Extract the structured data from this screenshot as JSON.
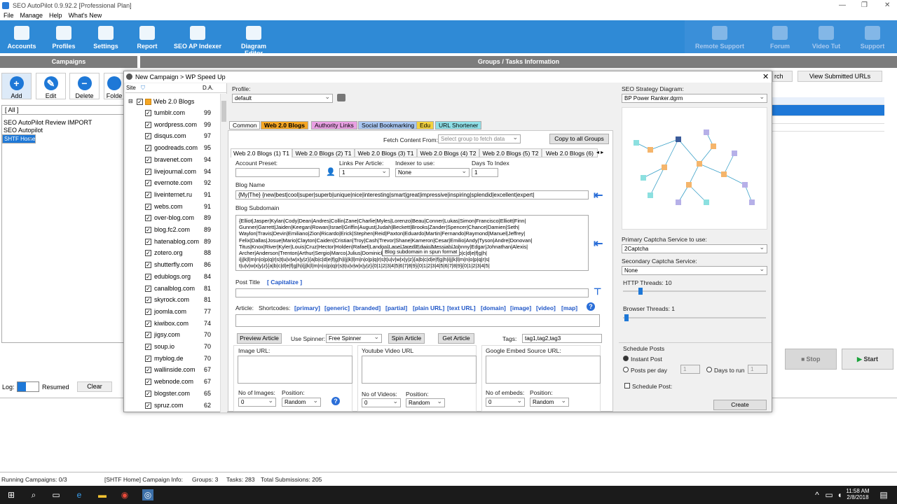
{
  "window": {
    "title": "SEO AutoPilot 0.9.92.2 [Professional Plan]"
  },
  "menu": [
    "File",
    "Manage",
    "Help",
    "What's New"
  ],
  "toolbar": {
    "left": [
      {
        "label": "Accounts",
        "icon": "accounts-icon"
      },
      {
        "label": "Profiles",
        "icon": "profiles-icon"
      },
      {
        "label": "Settings",
        "icon": "settings-icon"
      },
      {
        "label": "Report",
        "icon": "report-icon"
      },
      {
        "label": "SEO AP Indexer",
        "icon": "indexer-icon"
      },
      {
        "label": "Diagram Editor",
        "icon": "diagram-icon"
      }
    ],
    "right": [
      {
        "label": "Remote Support",
        "icon": "remote-support-icon"
      },
      {
        "label": "Forum",
        "icon": "forum-icon"
      },
      {
        "label": "Video Tut",
        "icon": "video-icon"
      },
      {
        "label": "Support",
        "icon": "support-icon"
      }
    ]
  },
  "bars": {
    "campaigns": "Campaigns",
    "groups": "Groups / Tasks Information"
  },
  "side_buttons": [
    {
      "label": "Add",
      "glyph": "+",
      "color": "#1e78d7"
    },
    {
      "label": "Edit",
      "glyph": "✎",
      "color": "#1e78d7"
    },
    {
      "label": "Delete",
      "glyph": "−",
      "color": "#1e78d7"
    },
    {
      "label": "Folde",
      "glyph": "",
      "color": "#1e78d7"
    }
  ],
  "campaigns": {
    "all": "[ All ]",
    "items": [
      "SEO AutoPilot Review IMPORT",
      "SEO Autopilot",
      "SHTF Home"
    ],
    "selected": 2
  },
  "right_bg": {
    "search_btn": "rch",
    "view_btn": "View Submitted URLs",
    "stop": "Stop",
    "start": "Start"
  },
  "log": {
    "label": "Log:",
    "status": "Resumed",
    "clear": "Clear"
  },
  "status": {
    "running": "Running Campaigns: 0/3",
    "info": "[SHTF Home] Campaign Info:",
    "groups": "Groups: 3",
    "tasks": "Tasks: 283",
    "subs": "Total Submissions: 205"
  },
  "clock": {
    "time": "11:58 AM",
    "date": "2/8/2018"
  },
  "dialog": {
    "title": "New Campaign > WP Speed Up",
    "site_header": {
      "site": "Site",
      "da": "D.A."
    },
    "group": "Web 2.0 Blogs",
    "sites": [
      {
        "name": "tumblr.com",
        "da": "99"
      },
      {
        "name": "wordpress.com",
        "da": "99"
      },
      {
        "name": "disqus.com",
        "da": "97"
      },
      {
        "name": "goodreads.com",
        "da": "95"
      },
      {
        "name": "bravenet.com",
        "da": "94"
      },
      {
        "name": "livejournal.com",
        "da": "94"
      },
      {
        "name": "evernote.com",
        "da": "92"
      },
      {
        "name": "liveinternet.ru",
        "da": "91"
      },
      {
        "name": "webs.com",
        "da": "91"
      },
      {
        "name": "over-blog.com",
        "da": "89"
      },
      {
        "name": "blog.fc2.com",
        "da": "89"
      },
      {
        "name": "hatenablog.com",
        "da": "89"
      },
      {
        "name": "zotero.org",
        "da": "88"
      },
      {
        "name": "shutterfly.com",
        "da": "86"
      },
      {
        "name": "edublogs.org",
        "da": "84"
      },
      {
        "name": "canalblog.com",
        "da": "81"
      },
      {
        "name": "skyrock.com",
        "da": "81"
      },
      {
        "name": "joomla.com",
        "da": "77"
      },
      {
        "name": "kiwibox.com",
        "da": "74"
      },
      {
        "name": "jigsy.com",
        "da": "70"
      },
      {
        "name": "soup.io",
        "da": "70"
      },
      {
        "name": "myblog.de",
        "da": "70"
      },
      {
        "name": "wallinside.com",
        "da": "67"
      },
      {
        "name": "webnode.com",
        "da": "67"
      },
      {
        "name": "blogster.com",
        "da": "65"
      },
      {
        "name": "spruz.com",
        "da": "62"
      }
    ],
    "profile_label": "Profile:",
    "profile_value": "default",
    "tabs": [
      {
        "label": "Common",
        "bg": "#ffffff"
      },
      {
        "label": "Web 2.0 Blogs",
        "bg": "#f5a623"
      },
      {
        "label": "Authority Links",
        "bg": "#e9a0e3"
      },
      {
        "label": "Social Bookmarking",
        "bg": "#a9c7f2"
      },
      {
        "label": "Edu",
        "bg": "#f3d23f"
      },
      {
        "label": "URL Shortener",
        "bg": "#8fe0e8"
      }
    ],
    "fetch_label": "Fetch Content From:",
    "fetch_placeholder": "Select group to fetch data",
    "copy_btn": "Copy to all Groups",
    "inner_tabs": [
      "Web 2.0 Blogs (1) T1",
      "Web 2.0 Blogs (2) T1",
      "Web 2.0 Blogs (3) T1",
      "Web 2.0 Blogs (4) T2",
      "Web 2.0 Blogs (5) T2",
      "Web 2.0 Blogs (6)"
    ],
    "account_preset": "Account Preset:",
    "links_per_article": "Links Per Article:",
    "links_value": "1",
    "indexer_label": "Indexer to use:",
    "indexer_value": "None",
    "days_label": "Days To Index",
    "days_value": "1",
    "blog_name_label": "Blog Name",
    "blog_name_value": "{My|The} {new|best|cool|super|superb|unique|nice|interesting|smart|great|impressive|inspiring|splendid|excellent|expert|",
    "subdomain_label": "Blog Subdomain",
    "subdomain_lines": [
      "{Elliot|Jasper|Kylan|Cody|Dean|Andres|Collin|Zane|Charlie|Myles|Lorenzo|Beau|Conner|Lukas|Simon|Francisco|Elliott|Finn|",
      "Gunner|Garrett|Jaiden|Keegan|Rowan|Israel|Griffin|August|Judah|Beckett|Brooks|Zander|Spencer|Chance|Damien|Seth|",
      "Waylon|Travis|Devin|Emiliano|Zion|Ricardo|Erick|Stephen|Reid|Paxton|Eduardo|Martin|Fernando|Raymond|Manuel|Jeffrey|",
      "Felix|Dallas|Josue|Mario|Clayton|Caiden|Cristian|Troy|Cash|Trevor|Shane|Kameron|Cesar|Emilio|Andy|Tyson|Andre|Donovan|",
      "Titus|Knox|River|Kyler|Louis|Cruz|Hector|Holden|Rafael|Landon|Lane|Jared|Edwin|Messiah|Johnny|Edgar|Johnathan|Alexis|",
      "Archer|Anderson|Trenton|Arthur|Sergio|Marco|Julius|Dominick|Jalen|Dante|Angelo|Gregory}{a|b|c|d|e|f|g|h|",
      "i|j|k|l|m|n|o|p|q|r|s|t|u|v|w|x|y|z}{a|b|c|d|e|f|g|h|i|j|k|l|m|n|o|p|q|r|s|t|u|v|w|x|y|z}{a|b|c|d|e|f|g|h|i|j|k|l|m|n|o|p|q|r|s|",
      "t|u|v|w|x|y|z}{a|b|c|d|e|f|g|h|i|j|k|l|m|n|o|p|q|r|s|t|u|v|w|x|y|z}{0|1|2|3|4|5|6|7|8|9}{0|1|2|3|4|5|6|7|8|9}{0|1|2|3|4|5|"
    ],
    "tooltip": "Blog subdomain in spun format",
    "post_title_label": "Post Title",
    "capitalize": "[ Capitalize ]",
    "article_label": "Article:",
    "shortcodes_label": "Shortcodes:",
    "shortcodes": [
      "[primary]",
      "[generic]",
      "[branded]",
      "[partial]",
      "[plain URL]",
      "[text URL]",
      "[domain]",
      "[image]",
      "[video]",
      "[map]"
    ],
    "preview_btn": "Preview Article",
    "spinner_label": "Use Spinner:",
    "spinner_value": "Free Spinner",
    "spin_btn": "Spin Article",
    "get_btn": "Get Article",
    "tags_label": "Tags:",
    "tags_value": "tag1,tag2,tag3",
    "image_url": "Image URL:",
    "youtube_url": "Youtube Video URL",
    "embed_url": "Google Embed Source URL:",
    "no_images": "No of Images:",
    "no_videos": "No of Videos:",
    "no_embeds": "No of embeds:",
    "position": "Position:",
    "zero": "0",
    "random": "Random",
    "strategy_label": "SEO Strategy Diagram:",
    "strategy_value": "BP Power Ranker.dgrm",
    "primary_captcha_label": "Primary Captcha Service to use:",
    "primary_captcha_value": "2Captcha",
    "secondary_captcha_label": "Secondary Captcha Service:",
    "secondary_captcha_value": "None",
    "http_threads": "HTTP Threads: 10",
    "browser_threads": "Browser Threads: 1",
    "schedule_label": "Schedule Posts",
    "instant": "Instant Post",
    "per_day": "Posts per day",
    "days_to_run": "Days to run",
    "one": "1",
    "schedule_post": "Schedule Post:",
    "create_btn": "Create"
  }
}
